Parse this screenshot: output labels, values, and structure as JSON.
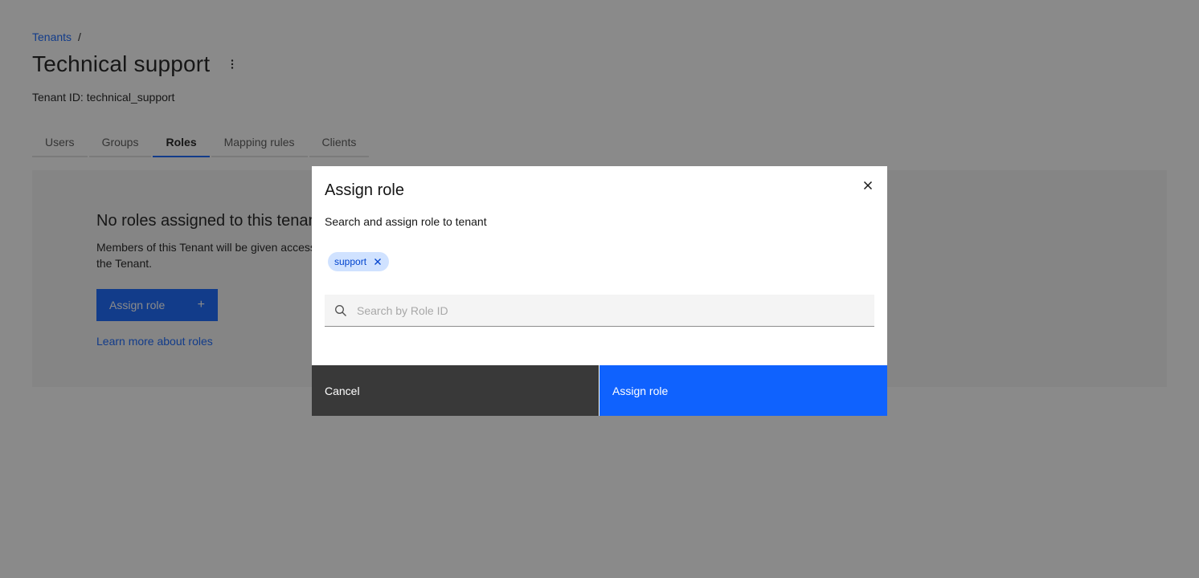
{
  "breadcrumb": {
    "parent": "Tenants",
    "separator": "/"
  },
  "page": {
    "title": "Technical support",
    "tenant_id_label": "Tenant ID: technical_support"
  },
  "tabs": [
    {
      "label": "Users",
      "active": false
    },
    {
      "label": "Groups",
      "active": false
    },
    {
      "label": "Roles",
      "active": true
    },
    {
      "label": "Mapping rules",
      "active": false
    },
    {
      "label": "Clients",
      "active": false
    }
  ],
  "empty_state": {
    "title": "No roles assigned to this tenant",
    "description": "Members of this Tenant will be given access to the Tenant.",
    "button_label": "Assign role",
    "button_icon": "+",
    "learn_more": "Learn more about roles"
  },
  "modal": {
    "title": "Assign role",
    "description": "Search and assign role to tenant",
    "selected_tags": [
      "support"
    ],
    "search_placeholder": "Search by Role ID",
    "search_value": "",
    "cancel_label": "Cancel",
    "primary_label": "Assign role"
  },
  "colors": {
    "accent": "#0f62fe",
    "overlay": "rgba(22,22,22,0.5)",
    "tag_bg": "#d0e2ff",
    "cancel_bg": "#393939"
  },
  "icons": {
    "overflow": "overflow-menu-vertical-icon",
    "close": "close-icon",
    "tag_close": "close-icon",
    "search": "search-icon",
    "add": "add-icon"
  }
}
